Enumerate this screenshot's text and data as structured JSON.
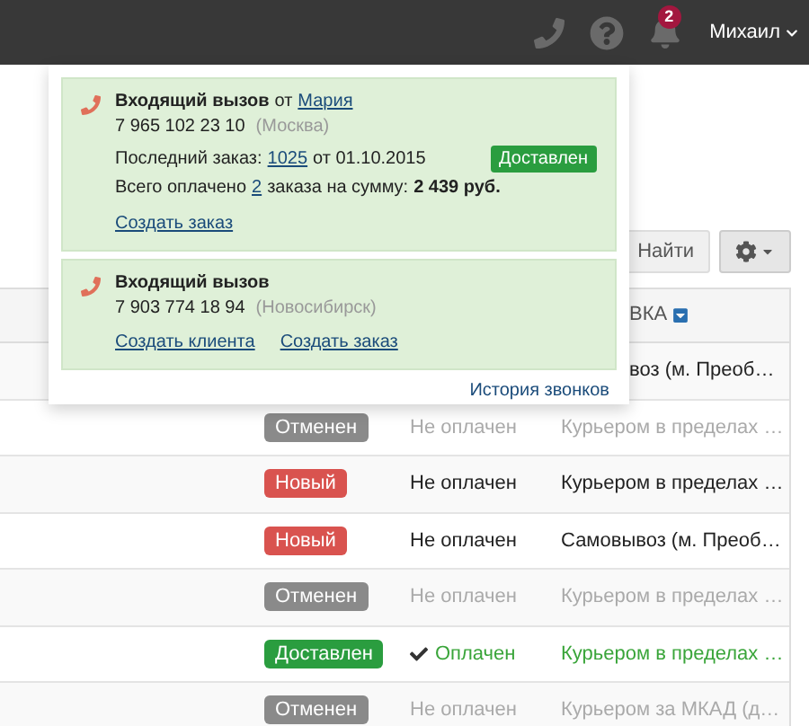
{
  "top_bar": {
    "notification_count": "2",
    "user": "Михаил"
  },
  "toolbar": {
    "find_button": "Найти"
  },
  "calls_popover": {
    "calls": [
      {
        "title": "Входящий вызов",
        "from_word": "от",
        "caller": "Мария",
        "phone": "7 965 102 23 10",
        "city": "(Москва)",
        "last_order": {
          "label": "Последний заказ:",
          "number": "1025",
          "date": "от 01.10.2015",
          "status": "Доставлен"
        },
        "total": {
          "prefix": "Всего оплачено",
          "count": "2",
          "middle": "заказа на сумму:",
          "sum": "2 439 руб."
        },
        "actions": [
          "Создать заказ"
        ]
      },
      {
        "title": "Входящий вызов",
        "phone": "7 903 774 18 94",
        "city": "(Новосибирск)",
        "actions": [
          "Создать клиента",
          "Создать заказ"
        ]
      }
    ],
    "history_link": "История звонков"
  },
  "table": {
    "columns": [
      {
        "label": "ВКА"
      }
    ],
    "rows": [
      {
        "kind": "partial",
        "delivery": "воз (м. Преоб…"
      },
      {
        "kind": "cancelled",
        "status": "Отменен",
        "payment": "Не оплачен",
        "paid": false,
        "delivery": "Курьером в пределах …"
      },
      {
        "kind": "new",
        "status": "Новый",
        "payment": "Не оплачен",
        "paid": false,
        "delivery": "Курьером в пределах …"
      },
      {
        "kind": "new",
        "status": "Новый",
        "payment": "Не оплачен",
        "paid": false,
        "delivery": "Самовывоз (м. Преоб…"
      },
      {
        "kind": "cancelled",
        "status": "Отменен",
        "payment": "Не оплачен",
        "paid": false,
        "delivery": "Курьером в пределах …"
      },
      {
        "kind": "delivered",
        "status": "Доставлен",
        "payment": "Оплачен",
        "paid": true,
        "delivery": "Курьером в пределах …"
      },
      {
        "kind": "cancelled",
        "status": "Отменен",
        "payment": "Не оплачен",
        "paid": false,
        "delivery": "Курьером за МКАД (д…"
      }
    ]
  }
}
